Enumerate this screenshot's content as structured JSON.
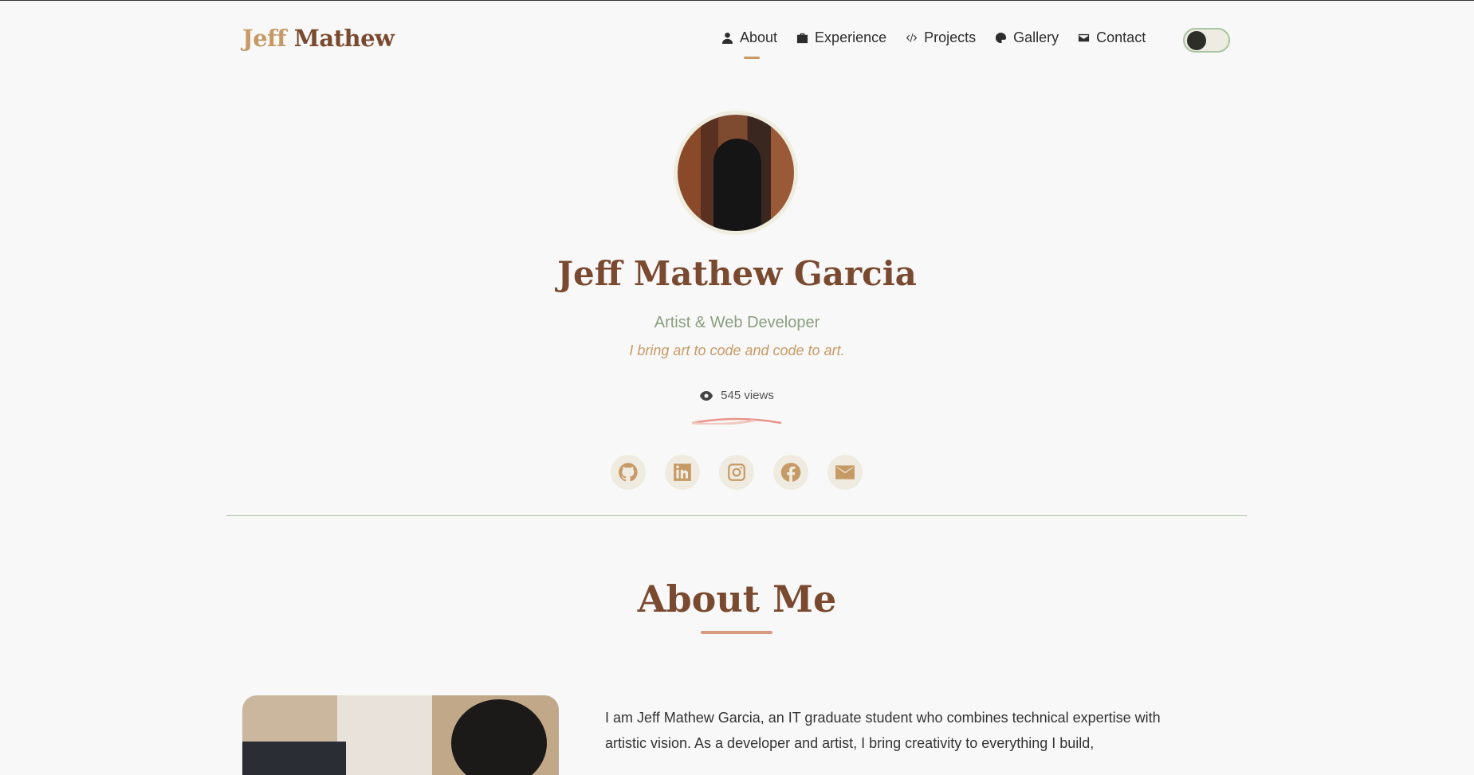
{
  "header": {
    "logo_first": "Jeff",
    "logo_last": "Mathew",
    "nav": [
      {
        "label": "About",
        "icon": "user-icon",
        "active": true
      },
      {
        "label": "Experience",
        "icon": "briefcase-icon"
      },
      {
        "label": "Projects",
        "icon": "code-icon"
      },
      {
        "label": "Gallery",
        "icon": "palette-icon"
      },
      {
        "label": "Contact",
        "icon": "envelope-icon"
      }
    ],
    "theme_toggle": "dark-mode-toggle"
  },
  "hero": {
    "name": "Jeff Mathew Garcia",
    "role": "Artist & Web Developer",
    "tagline": "I bring art to code and code to art.",
    "views": "545 views",
    "socials": [
      "github-icon",
      "linkedin-icon",
      "instagram-icon",
      "facebook-icon",
      "envelope-icon"
    ]
  },
  "about": {
    "heading": "About Me",
    "paragraph": "I am Jeff Mathew Garcia, an IT graduate student who combines technical expertise with artistic vision. As a developer and artist, I bring creativity to everything I build,"
  },
  "colors": {
    "accent": "#c69a66",
    "brown": "#7a4a30",
    "sage": "#8a9e7e",
    "divider": "#a8c4a0"
  }
}
